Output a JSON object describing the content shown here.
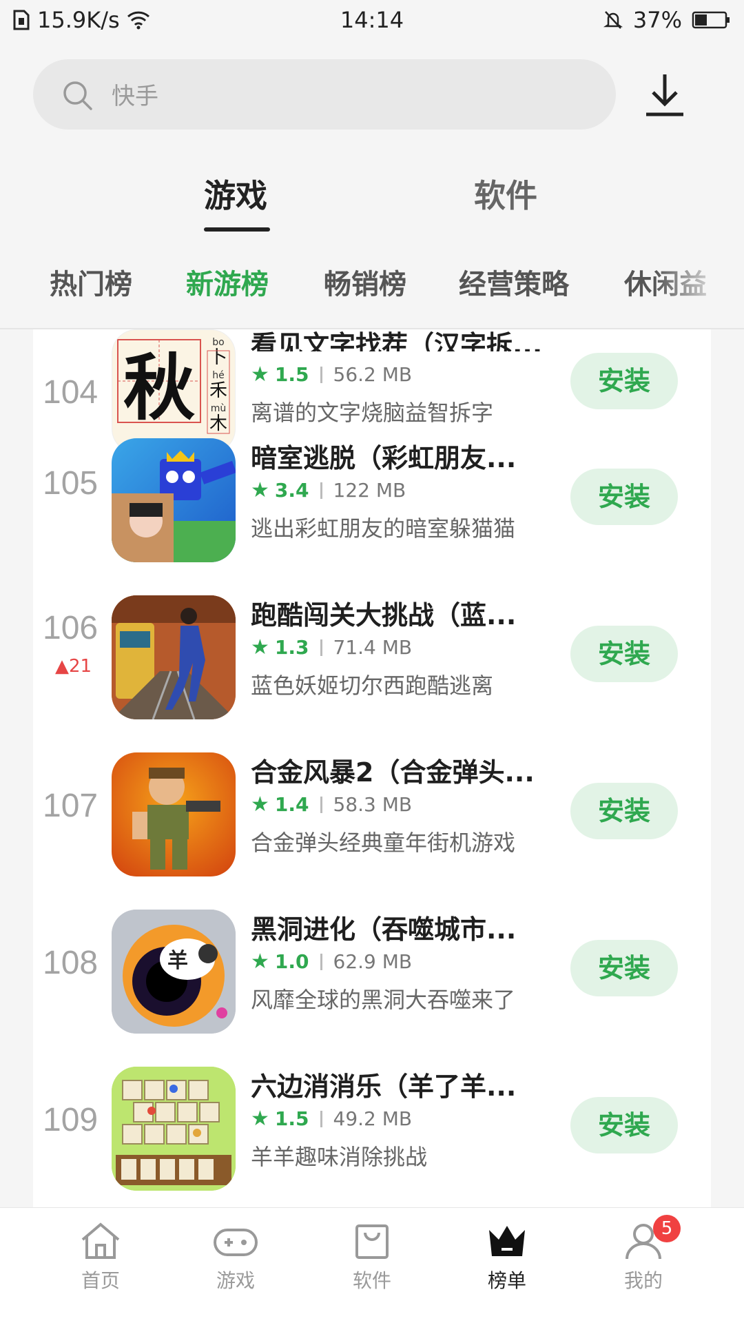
{
  "status": {
    "speed": "15.9K/s",
    "time": "14:14",
    "battery": "37%"
  },
  "search": {
    "placeholder": "快手"
  },
  "main_tabs": [
    {
      "label": "游戏"
    },
    {
      "label": "软件"
    }
  ],
  "sub_tabs": [
    {
      "label": "热门榜"
    },
    {
      "label": "新游榜"
    },
    {
      "label": "畅销榜"
    },
    {
      "label": "经营策略"
    },
    {
      "label": "休闲益"
    }
  ],
  "install_label": "安装",
  "rows": [
    {
      "rank": "104",
      "title": "看见文字找茬（汉字拆...",
      "rating": "1.5",
      "size": "56.2 MB",
      "desc": "离谱的文字烧脑益智拆字",
      "rank_change": ""
    },
    {
      "rank": "105",
      "title": "暗室逃脱（彩虹朋友...",
      "rating": "3.4",
      "size": "122 MB",
      "desc": "逃出彩虹朋友的暗室躲猫猫",
      "rank_change": ""
    },
    {
      "rank": "106",
      "title": "跑酷闯关大挑战（蓝...",
      "rating": "1.3",
      "size": "71.4 MB",
      "desc": "蓝色妖姬切尔西跑酷逃离",
      "rank_change": "21"
    },
    {
      "rank": "107",
      "title": "合金风暴2（合金弹头...",
      "rating": "1.4",
      "size": "58.3 MB",
      "desc": "合金弹头经典童年街机游戏",
      "rank_change": ""
    },
    {
      "rank": "108",
      "title": "黑洞进化（吞噬城市...",
      "rating": "1.0",
      "size": "62.9 MB",
      "desc": "风靡全球的黑洞大吞噬来了",
      "rank_change": ""
    },
    {
      "rank": "109",
      "title": "六边消消乐（羊了羊...",
      "rating": "1.5",
      "size": "49.2 MB",
      "desc": "羊羊趣味消除挑战",
      "rank_change": ""
    }
  ],
  "icon1": {
    "big": "秋",
    "small1": "卜",
    "small2": "禾",
    "small3": "木",
    "py1": "bo",
    "py2": "hé",
    "py3": "mù"
  },
  "icon5": {
    "text": "羊"
  },
  "nav": [
    {
      "label": "首页",
      "icon": "home-icon"
    },
    {
      "label": "游戏",
      "icon": "gamepad-icon"
    },
    {
      "label": "软件",
      "icon": "bag-icon"
    },
    {
      "label": "榜单",
      "icon": "crown-icon"
    },
    {
      "label": "我的",
      "icon": "user-icon"
    }
  ],
  "nav_badge": "5",
  "colors": {
    "accent": "#2fa84f",
    "install_bg": "#e2f3e6",
    "badge": "#f04141"
  }
}
